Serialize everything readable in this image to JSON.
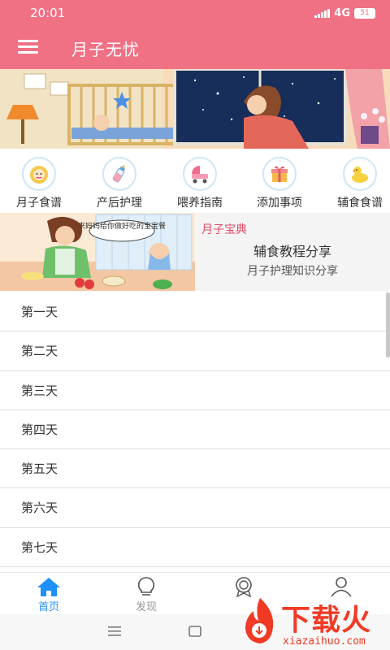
{
  "status": {
    "time": "20:01",
    "network": "4G",
    "battery": "51"
  },
  "app": {
    "title": "月子无忧"
  },
  "categories": [
    {
      "label": "月子食谱",
      "icon": "baby-face-icon"
    },
    {
      "label": "产后护理",
      "icon": "baby-bottle-icon"
    },
    {
      "label": "喂养指南",
      "icon": "stroller-icon"
    },
    {
      "label": "添加事项",
      "icon": "gift-box-icon"
    },
    {
      "label": "辅食食谱",
      "icon": "rubber-duck-icon"
    }
  ],
  "feature": {
    "tag": "月子宝典",
    "title": "辅食教程分享",
    "subtitle": "月子护理知识分享",
    "bubble": "来妈妈给你做好吃的宝宝餐"
  },
  "days": [
    "第一天",
    "第二天",
    "第三天",
    "第四天",
    "第五天",
    "第六天",
    "第七天"
  ],
  "tabs": [
    {
      "label": "首页",
      "icon": "home-icon",
      "active": true
    },
    {
      "label": "发现",
      "icon": "lightbulb-icon",
      "active": false
    },
    {
      "label": "",
      "icon": "award-badge-icon",
      "active": false
    },
    {
      "label": "",
      "icon": "user-icon",
      "active": false
    }
  ],
  "watermark": {
    "text": "下载火",
    "domain": "xiazaihuo.com"
  },
  "colors": {
    "primary": "#f07184",
    "accent_red": "#e44c66",
    "tab_active": "#1e90ff"
  }
}
